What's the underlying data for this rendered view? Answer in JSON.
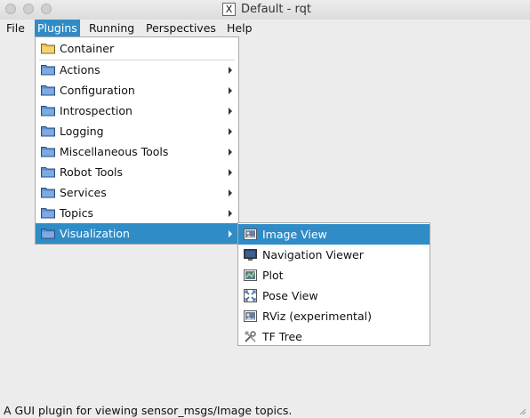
{
  "window": {
    "title": "Default - rqt"
  },
  "menubar": [
    {
      "label": "File"
    },
    {
      "label": "Plugins"
    },
    {
      "label": "Running"
    },
    {
      "label": "Perspectives"
    },
    {
      "label": "Help"
    }
  ],
  "plugins_menu": {
    "container": "Container",
    "items": [
      {
        "label": "Actions"
      },
      {
        "label": "Configuration"
      },
      {
        "label": "Introspection"
      },
      {
        "label": "Logging"
      },
      {
        "label": "Miscellaneous Tools"
      },
      {
        "label": "Robot Tools"
      },
      {
        "label": "Services"
      },
      {
        "label": "Topics"
      },
      {
        "label": "Visualization"
      }
    ]
  },
  "visualization_menu": {
    "items": [
      {
        "label": "Image View",
        "icon": "image-view-icon"
      },
      {
        "label": "Navigation Viewer",
        "icon": "monitor-icon"
      },
      {
        "label": "Plot",
        "icon": "plot-icon"
      },
      {
        "label": "Pose View",
        "icon": "pose-view-icon"
      },
      {
        "label": "RViz (experimental)",
        "icon": "rviz-icon"
      },
      {
        "label": "TF Tree",
        "icon": "tools-icon"
      }
    ]
  },
  "status_bar": {
    "text": "A GUI plugin for viewing sensor_msgs/Image topics."
  },
  "colors": {
    "highlight": "#308cc6",
    "background": "#ececec"
  }
}
